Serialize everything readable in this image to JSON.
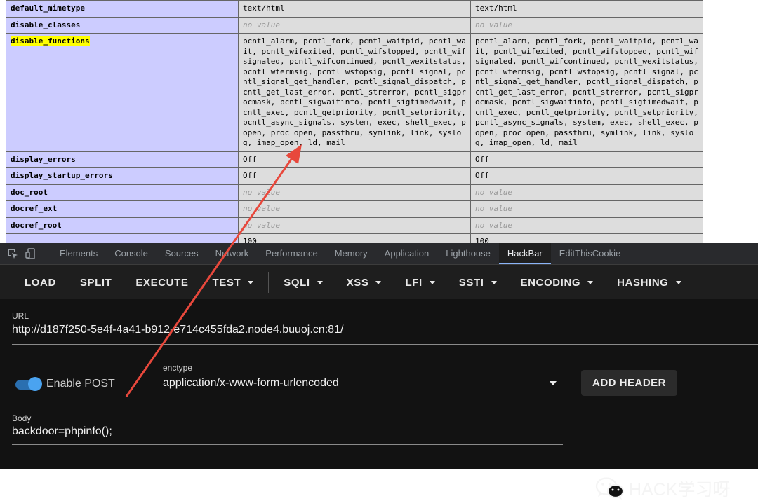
{
  "phpinfo": {
    "rows": [
      {
        "key": "default_mimetype",
        "local": "text/html",
        "master": "text/html",
        "no_value": false
      },
      {
        "key": "disable_classes",
        "local": "no value",
        "master": "no value",
        "no_value": true
      },
      {
        "key": "disable_functions",
        "local": "pcntl_alarm, pcntl_fork, pcntl_waitpid, pcntl_wait, pcntl_wifexited, pcntl_wifstopped, pcntl_wifsignaled, pcntl_wifcontinued, pcntl_wexitstatus, pcntl_wtermsig, pcntl_wstopsig, pcntl_signal, pcntl_signal_get_handler, pcntl_signal_dispatch, pcntl_get_last_error, pcntl_strerror, pcntl_sigprocmask, pcntl_sigwaitinfo, pcntl_sigtimedwait, pcntl_exec, pcntl_getpriority, pcntl_setpriority, pcntl_async_signals, system, exec, shell_exec, popen, proc_open, passthru, symlink, link, syslog, imap_open, ld, mail",
        "master": "pcntl_alarm, pcntl_fork, pcntl_waitpid, pcntl_wait, pcntl_wifexited, pcntl_wifstopped, pcntl_wifsignaled, pcntl_wifcontinued, pcntl_wexitstatus, pcntl_wtermsig, pcntl_wstopsig, pcntl_signal, pcntl_signal_get_handler, pcntl_signal_dispatch, pcntl_get_last_error, pcntl_strerror, pcntl_sigprocmask, pcntl_sigwaitinfo, pcntl_sigtimedwait, pcntl_exec, pcntl_getpriority, pcntl_setpriority, pcntl_async_signals, system, exec, shell_exec, popen, proc_open, passthru, symlink, link, syslog, imap_open, ld, mail",
        "no_value": false,
        "highlight": true
      },
      {
        "key": "display_errors",
        "local": "Off",
        "master": "Off",
        "no_value": false
      },
      {
        "key": "display_startup_errors",
        "local": "Off",
        "master": "Off",
        "no_value": false
      },
      {
        "key": "doc_root",
        "local": "no value",
        "master": "no value",
        "no_value": true
      },
      {
        "key": "docref_ext",
        "local": "no value",
        "master": "no value",
        "no_value": true
      },
      {
        "key": "docref_root",
        "local": "no value",
        "master": "no value",
        "no_value": true
      },
      {
        "key": "",
        "local": "100",
        "master": "100",
        "no_value": false
      }
    ]
  },
  "devtools": {
    "tabs": [
      "Elements",
      "Console",
      "Sources",
      "Network",
      "Performance",
      "Memory",
      "Application",
      "Lighthouse",
      "HackBar",
      "EditThisCookie"
    ],
    "active_tab": "HackBar"
  },
  "hackbar": {
    "toolbar": [
      {
        "label": "LOAD",
        "dropdown": false
      },
      {
        "label": "SPLIT",
        "dropdown": false
      },
      {
        "label": "EXECUTE",
        "dropdown": false
      },
      {
        "label": "TEST",
        "dropdown": true
      },
      {
        "label": "SQLI",
        "dropdown": true
      },
      {
        "label": "XSS",
        "dropdown": true
      },
      {
        "label": "LFI",
        "dropdown": true
      },
      {
        "label": "SSTI",
        "dropdown": true
      },
      {
        "label": "ENCODING",
        "dropdown": true
      },
      {
        "label": "HASHING",
        "dropdown": true
      }
    ],
    "url_label": "URL",
    "url_value": "http://d187f250-5e4f-4a41-b912-e714c455fda2.node4.buuoj.cn:81/",
    "enable_post_label": "Enable POST",
    "enable_post_on": true,
    "enctype_label": "enctype",
    "enctype_value": "application/x-www-form-urlencoded",
    "add_header_label": "ADD HEADER",
    "body_label": "Body",
    "body_value": "backdoor=phpinfo();"
  },
  "watermark": {
    "text": "HACK学习呀",
    "icon": "wechat-icon"
  },
  "colors": {
    "key_cell": "#ccccff",
    "value_cell": "#dddddd",
    "highlight": "#ffff00",
    "arrow": "#e8483c",
    "toggle": "#4aa3f0"
  }
}
